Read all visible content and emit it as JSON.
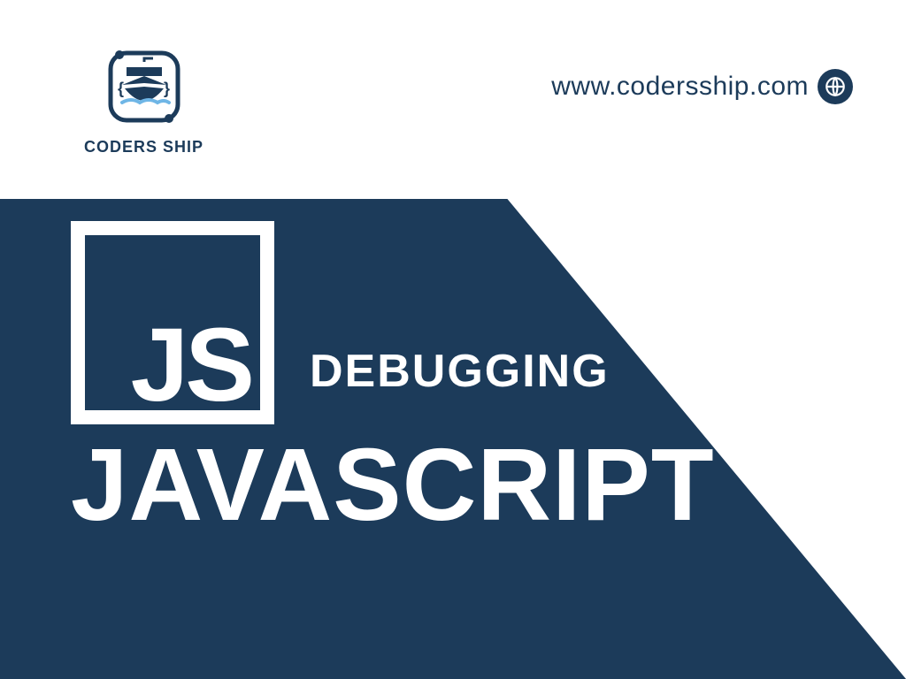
{
  "brand": {
    "name": "CODERS SHIP",
    "accent": "#1c3b5a"
  },
  "url": "www.codersship.com",
  "js_logo_text": "JS",
  "subtitle": "DEBUGGING",
  "title": "JAVASCRIPT"
}
